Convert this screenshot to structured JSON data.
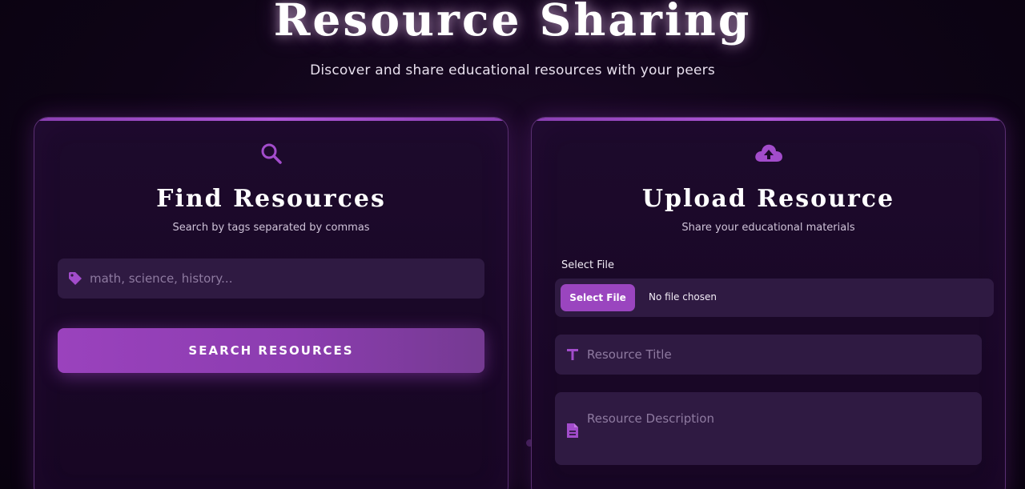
{
  "header": {
    "title": "Resource Sharing",
    "subtitle": "Discover and share educational resources with your peers"
  },
  "search_card": {
    "icon": "search-icon",
    "title": "Find Resources",
    "subtitle": "Search by tags separated by commas",
    "tags_input": {
      "icon": "tag-icon",
      "placeholder": "math, science, history...",
      "value": ""
    },
    "button_label": "SEARCH RESOURCES"
  },
  "upload_card": {
    "icon": "cloud-upload-icon",
    "title": "Upload Resource",
    "subtitle": "Share your educational materials",
    "file_label": "Select File",
    "file_button_label": "Select File",
    "file_status": "No file chosen",
    "title_input": {
      "icon": "text-icon",
      "placeholder": "Resource Title",
      "value": ""
    },
    "description_input": {
      "icon": "document-icon",
      "placeholder": "Resource Description",
      "value": ""
    }
  },
  "colors": {
    "accent": "#9a42bd",
    "background": "#0d0414",
    "card_background": "#1b0929",
    "field_background": "#2f1a42"
  }
}
